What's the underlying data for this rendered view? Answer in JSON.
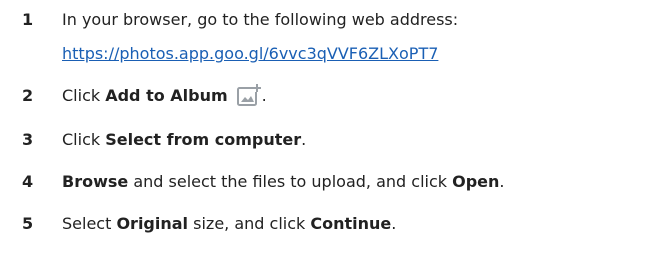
{
  "steps": [
    {
      "number": "1",
      "text": "In your browser, go to the following web address:",
      "link": "https://photos.app.goo.gl/6vvc3qVVF6ZLXoPT7"
    },
    {
      "number": "2",
      "pre": "Click ",
      "bold": "Add to Album",
      "icon": "add-to-album-icon",
      "post": "."
    },
    {
      "number": "3",
      "pre": "Click ",
      "bold": "Select from computer",
      "post": "."
    },
    {
      "number": "4",
      "bold1": "Browse",
      "mid": " and select the files to upload, and click ",
      "bold2": "Open",
      "post": "."
    },
    {
      "number": "5",
      "pre": "Select ",
      "bold1": "Original",
      "mid": " size, and click ",
      "bold2": "Continue",
      "post": "."
    }
  ],
  "colors": {
    "text": "#222222",
    "link": "#1a5fb4",
    "icon": "#9aa0a6"
  }
}
